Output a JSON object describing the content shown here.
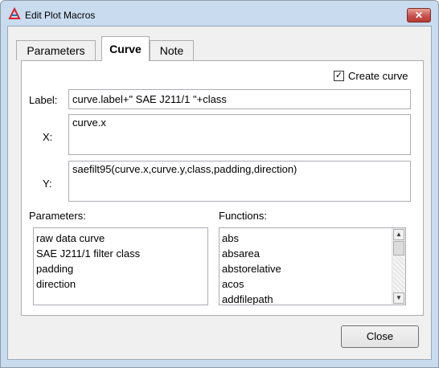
{
  "window": {
    "title": "Edit Plot Macros",
    "close_symbol": "✕"
  },
  "tabs": [
    {
      "label": "Parameters",
      "active": false
    },
    {
      "label": "Curve",
      "active": true
    },
    {
      "label": "Note",
      "active": false
    }
  ],
  "curve": {
    "create_curve_label": "Create curve",
    "create_curve_checked": true,
    "create_curve_mark": "✓",
    "label_caption": "Label:",
    "label_value": "curve.label+\" SAE J211/1 \"+class",
    "x_caption": "X:",
    "x_value": "curve.x",
    "y_caption": "Y:",
    "y_value": "saefilt95(curve.x,curve.y,class,padding,direction)",
    "parameters_caption": "Parameters:",
    "parameters": [
      "raw data curve",
      "SAE J211/1 filter class",
      "padding",
      "direction"
    ],
    "functions_caption": "Functions:",
    "functions": [
      "abs",
      "absarea",
      "abstorelative",
      "acos",
      "addfilepath"
    ]
  },
  "buttons": {
    "close_label": "Close"
  }
}
